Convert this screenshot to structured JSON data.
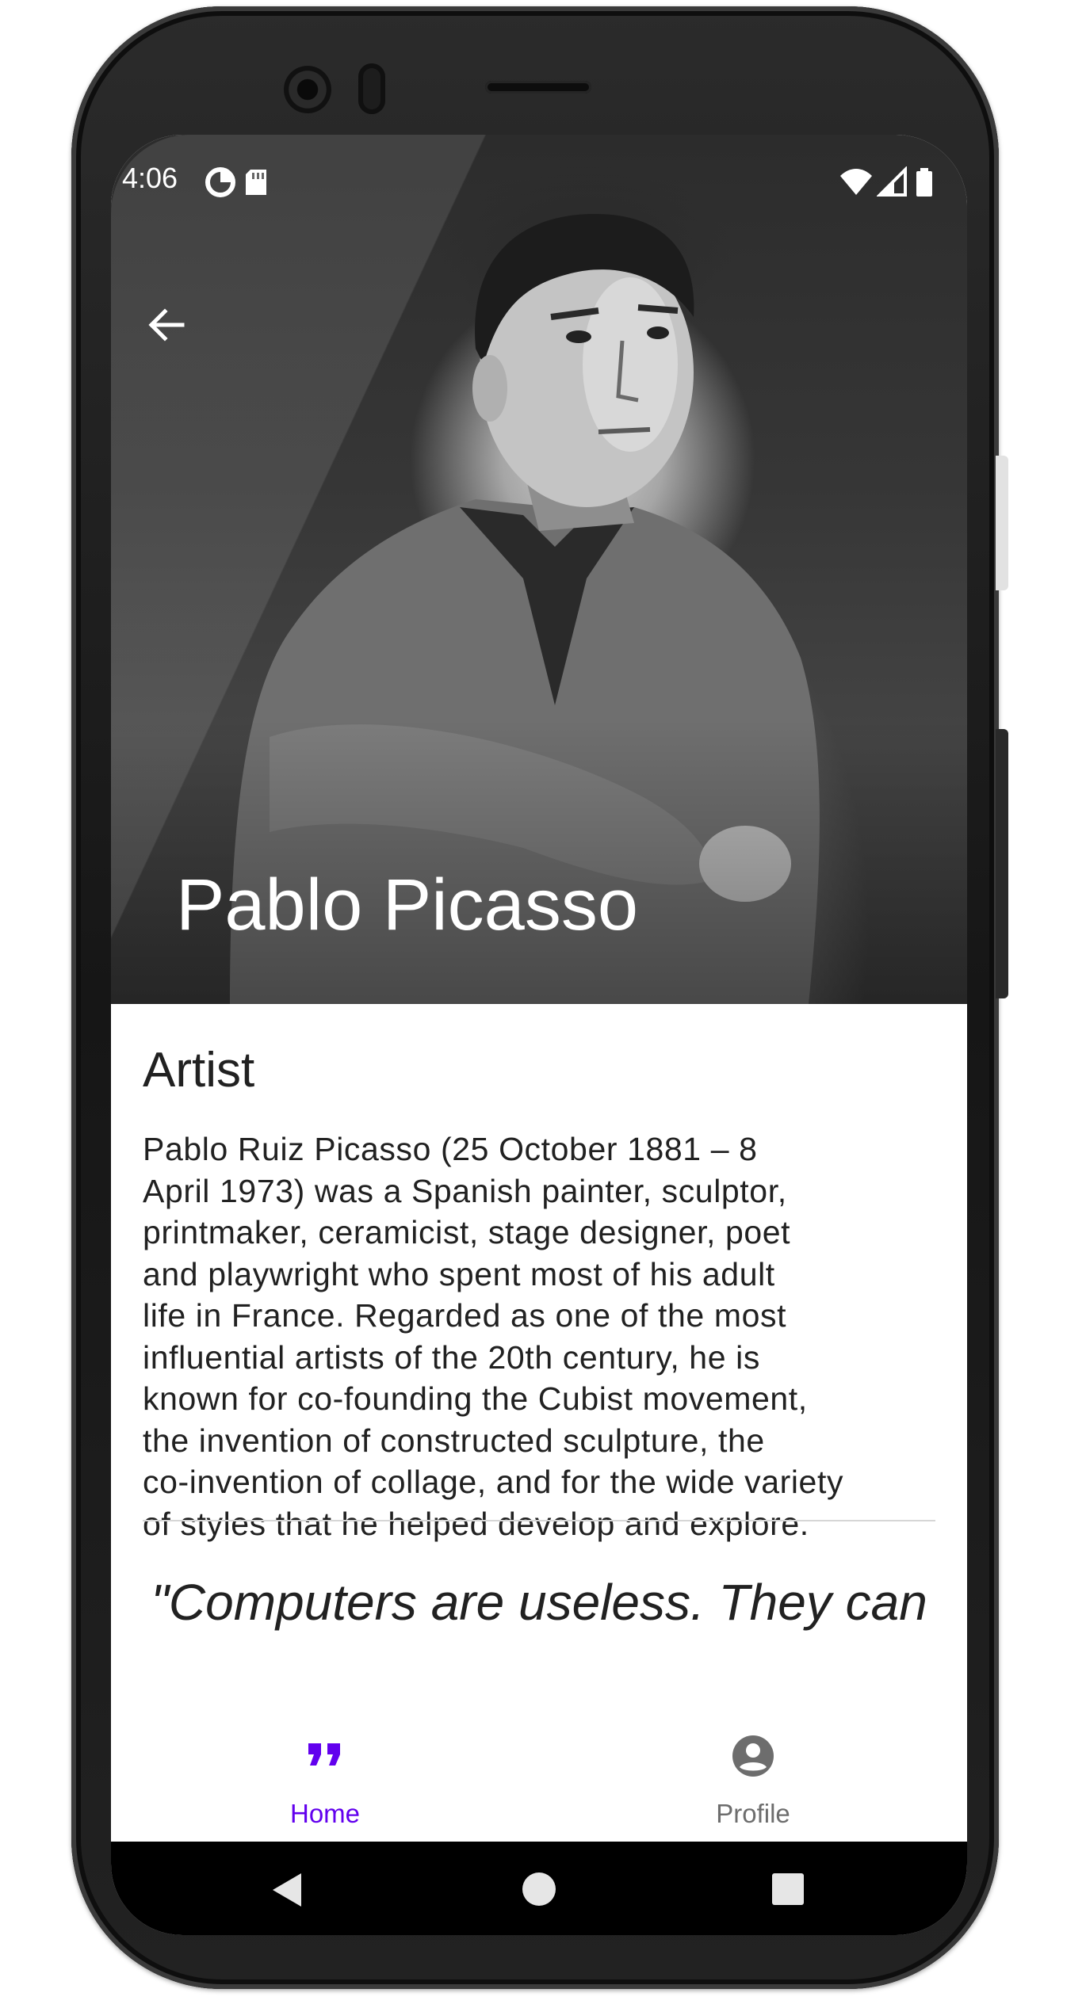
{
  "status_bar": {
    "time": "4:06"
  },
  "hero": {
    "title": "Pablo Picasso"
  },
  "content": {
    "section_title": "Artist",
    "bio_lines": [
      "Pablo Ruiz Picasso (25 October 1881 – 8",
      "April 1973) was a Spanish painter, sculptor,",
      "printmaker, ceramicist, stage designer, poet",
      "and playwright who spent most of his adult",
      "life in France. Regarded as one of the most",
      "influential artists of the 20th century, he is",
      "known for co-founding the Cubist movement,",
      "the invention of constructed sculpture, the",
      "co-invention of collage, and for the wide variety",
      "of styles that he helped develop and explore."
    ],
    "quote": "\"Computers are useless. They can"
  },
  "bottom_nav": {
    "home_label": "Home",
    "profile_label": "Profile",
    "active": "Home"
  },
  "colors": {
    "accent": "#6200ee",
    "inactive": "#6d6d6d",
    "text": "#212121"
  },
  "icons": {
    "back": "arrow-back-icon",
    "home": "format-quote-icon",
    "profile": "account-circle-icon",
    "status": [
      "data-saver-icon",
      "sd-card-icon",
      "wifi-icon",
      "cell-signal-icon",
      "battery-icon"
    ],
    "system_nav": [
      "back-triangle-icon",
      "home-circle-icon",
      "recents-square-icon"
    ]
  }
}
